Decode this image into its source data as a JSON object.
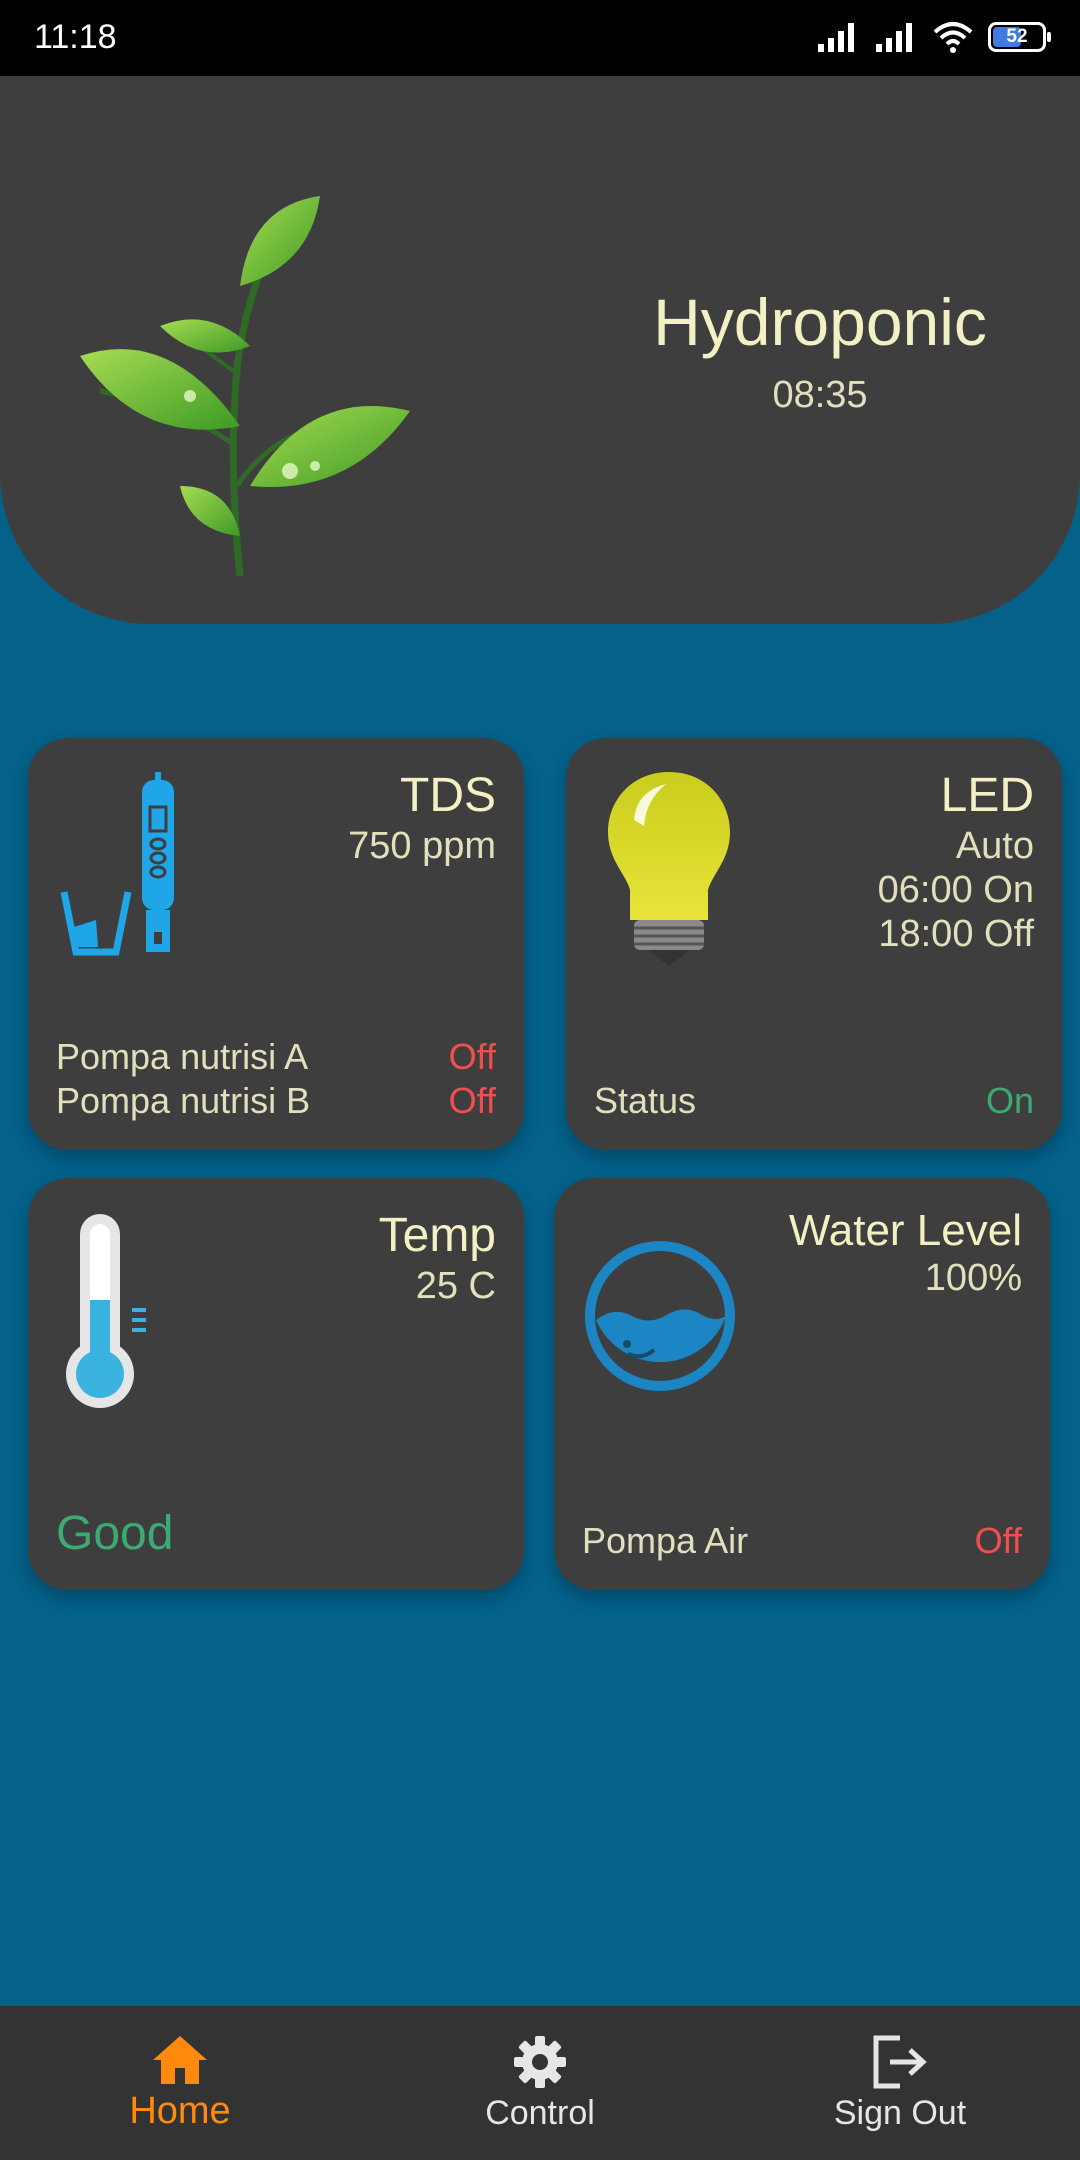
{
  "status_bar": {
    "time": "11:18",
    "battery": "52"
  },
  "header": {
    "title": "Hydroponic",
    "time": "08:35"
  },
  "tds": {
    "title": "TDS",
    "value": "750 ppm",
    "pump_a_label": "Pompa nutrisi A",
    "pump_a_state": "Off",
    "pump_b_label": "Pompa nutrisi B",
    "pump_b_state": "Off"
  },
  "led": {
    "title": "LED",
    "mode": "Auto",
    "on_time": "06:00 On",
    "off_time": "18:00 Off",
    "status_label": "Status",
    "status_value": "On"
  },
  "temp": {
    "title": "Temp",
    "value": "25 C",
    "condition": "Good"
  },
  "water": {
    "title": "Water Level",
    "value": "100%",
    "pump_label": "Pompa Air",
    "pump_state": "Off"
  },
  "nav": {
    "home": "Home",
    "control": "Control",
    "sign_out": "Sign Out"
  },
  "icons": {
    "tds": "tds-meter-icon",
    "led": "light-bulb-icon",
    "temp": "thermometer-icon",
    "water": "water-level-icon",
    "home": "home-icon",
    "control": "gear-icon",
    "sign_out": "logout-icon"
  },
  "colors": {
    "background": "#03618a",
    "card": "#3e3e3e",
    "accent_active": "#ff8a0d",
    "state_off": "#f24e4e",
    "state_on": "#3cab72",
    "title_text": "#f3f1c3"
  }
}
